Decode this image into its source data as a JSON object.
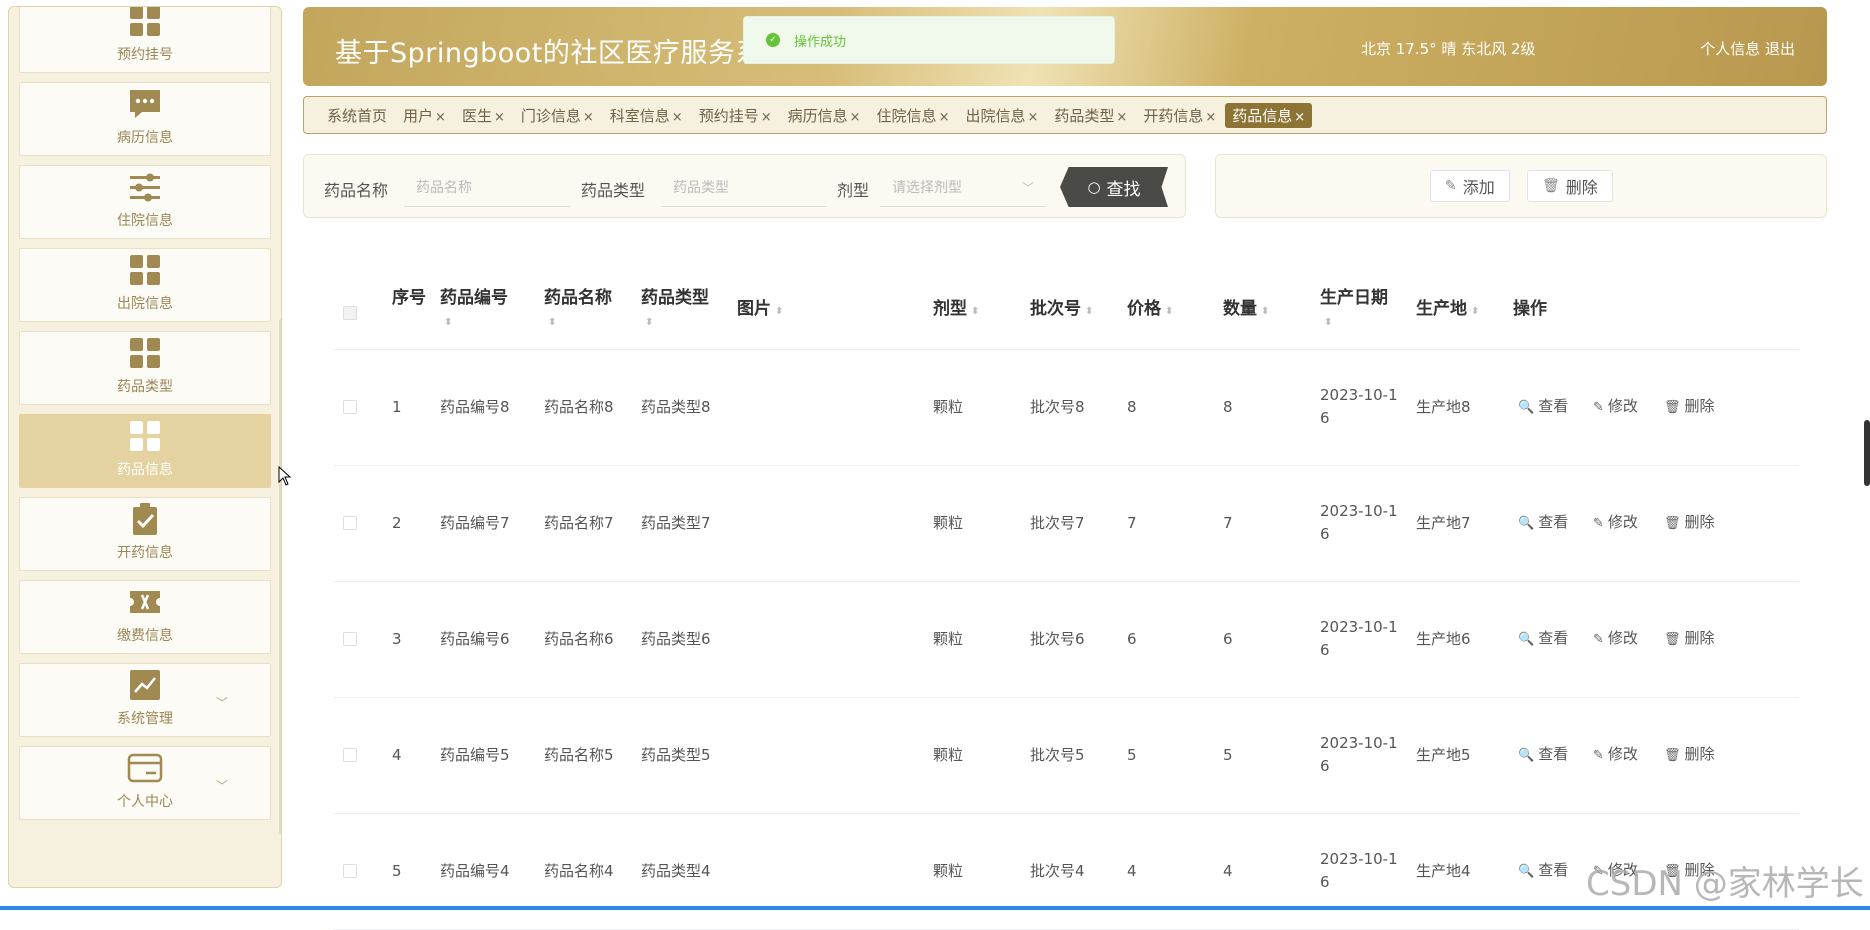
{
  "app": {
    "title": "基于Springboot的社区医疗服务系统",
    "weather": "北京  17.5°  晴  东北风  2级",
    "profile_link": "个人信息",
    "logout_link": "退出"
  },
  "toast": {
    "message": "操作成功"
  },
  "sidebar": {
    "items": [
      {
        "label": "预约挂号",
        "icon": "grid-icon"
      },
      {
        "label": "病历信息",
        "icon": "chat-icon"
      },
      {
        "label": "住院信息",
        "icon": "sliders-icon"
      },
      {
        "label": "出院信息",
        "icon": "grid-icon"
      },
      {
        "label": "药品类型",
        "icon": "grid-icon"
      },
      {
        "label": "药品信息",
        "icon": "grid-icon",
        "active": true
      },
      {
        "label": "开药信息",
        "icon": "clipboard-check-icon"
      },
      {
        "label": "缴费信息",
        "icon": "ticket-icon"
      },
      {
        "label": "系统管理",
        "icon": "chart-icon",
        "expandable": true
      },
      {
        "label": "个人中心",
        "icon": "card-icon",
        "expandable": true
      }
    ]
  },
  "tabs": [
    {
      "label": "系统首页",
      "closable": false
    },
    {
      "label": "用户",
      "closable": true
    },
    {
      "label": "医生",
      "closable": true
    },
    {
      "label": "门诊信息",
      "closable": true
    },
    {
      "label": "科室信息",
      "closable": true
    },
    {
      "label": "预约挂号",
      "closable": true
    },
    {
      "label": "病历信息",
      "closable": true
    },
    {
      "label": "住院信息",
      "closable": true
    },
    {
      "label": "出院信息",
      "closable": true
    },
    {
      "label": "药品类型",
      "closable": true
    },
    {
      "label": "开药信息",
      "closable": true
    },
    {
      "label": "药品信息",
      "closable": true,
      "active": true
    }
  ],
  "tab_close": "×",
  "search": {
    "name_label": "药品名称",
    "name_placeholder": "药品名称",
    "type_label": "药品类型",
    "type_placeholder": "药品类型",
    "form_label": "剂型",
    "form_placeholder": "请选择剂型",
    "find_button": "查找"
  },
  "actions": {
    "add": "添加",
    "delete": "删除"
  },
  "table": {
    "columns": [
      "序号",
      "药品编号",
      "药品名称",
      "药品类型",
      "图片",
      "剂型",
      "批次号",
      "价格",
      "数量",
      "生产日期",
      "生产地",
      "操作"
    ],
    "rows": [
      {
        "idx": "1",
        "code": "药品编号8",
        "name": "药品名称8",
        "type": "药品类型8",
        "form": "颗粒",
        "batch": "批次号8",
        "price": "8",
        "qty": "8",
        "date": "2023-10-16",
        "origin": "生产地8"
      },
      {
        "idx": "2",
        "code": "药品编号7",
        "name": "药品名称7",
        "type": "药品类型7",
        "form": "颗粒",
        "batch": "批次号7",
        "price": "7",
        "qty": "7",
        "date": "2023-10-16",
        "origin": "生产地7"
      },
      {
        "idx": "3",
        "code": "药品编号6",
        "name": "药品名称6",
        "type": "药品类型6",
        "form": "颗粒",
        "batch": "批次号6",
        "price": "6",
        "qty": "6",
        "date": "2023-10-16",
        "origin": "生产地6"
      },
      {
        "idx": "4",
        "code": "药品编号5",
        "name": "药品名称5",
        "type": "药品类型5",
        "form": "颗粒",
        "batch": "批次号5",
        "price": "5",
        "qty": "5",
        "date": "2023-10-16",
        "origin": "生产地5"
      },
      {
        "idx": "5",
        "code": "药品编号4",
        "name": "药品名称4",
        "type": "药品类型4",
        "form": "颗粒",
        "batch": "批次号4",
        "price": "4",
        "qty": "4",
        "date": "2023-10-16",
        "origin": "生产地4"
      }
    ],
    "row_actions": {
      "view": "查看",
      "edit": "修改",
      "delete": "删除"
    }
  },
  "watermark": "CSDN @家林学长",
  "colors": {
    "accent": "#8e7434",
    "sidebar_active": "#e4d3a0",
    "header_gold": "#c2a65c",
    "success": "#67c23a"
  }
}
